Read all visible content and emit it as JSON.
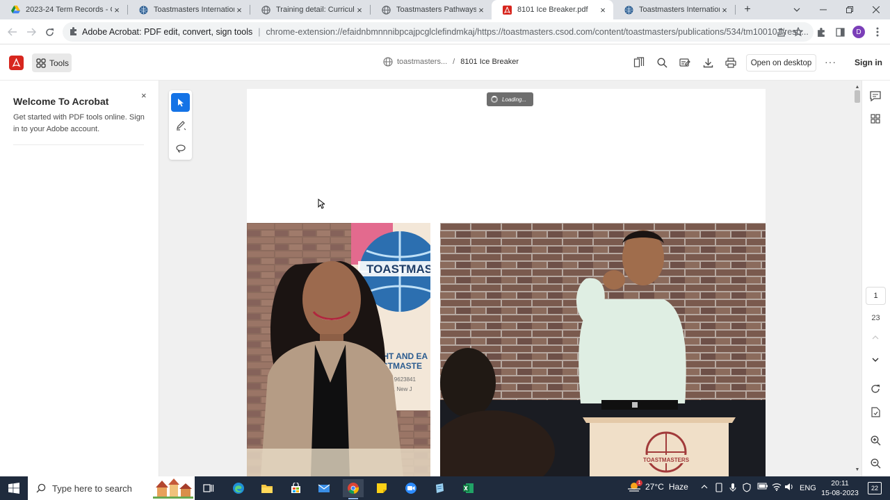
{
  "browser": {
    "tabs": [
      {
        "label": "2023-24 Term Records - Go",
        "icon": "google-drive-icon"
      },
      {
        "label": "Toastmasters International",
        "icon": "toastmasters-globe-icon"
      },
      {
        "label": "Training detail: Curriculum",
        "icon": "globe-icon"
      },
      {
        "label": "Toastmasters Pathways »» Ic",
        "icon": "globe-icon"
      },
      {
        "label": "8101 Ice Breaker.pdf",
        "icon": "adobe-pdf-icon",
        "active": true
      },
      {
        "label": "Toastmasters International",
        "icon": "toastmasters-globe-icon"
      }
    ],
    "close_glyph": "×",
    "new_tab_glyph": "+",
    "omnibox": {
      "site": "Adobe Acrobat: PDF edit, convert, sign tools",
      "separator": "|",
      "url": "chrome-extension://efaidnbmnnnibpcajpcglclefindmkaj/https://toastmasters.csod.com/content/toastmasters/publications/534/tm100101/reso..."
    },
    "profile_initial": "D"
  },
  "acrobat": {
    "tools_label": "Tools",
    "breadcrumb": {
      "site": "toastmasters...",
      "separator": "/",
      "document": "8101 Ice Breaker"
    },
    "open_desktop_label": "Open on desktop",
    "more_glyph": "···",
    "sign_in_label": "Sign in",
    "welcome": {
      "title": "Welcome To Acrobat",
      "body": "Get started with PDF tools online. Sign in to your Adobe account.",
      "close_glyph": "×"
    },
    "loading_label": "Loading...",
    "page_current": "1",
    "page_total": "23",
    "photo_sign": {
      "line1": "TOASTMAS",
      "line2": "GHT AND EA",
      "line3": "ASTMASTE",
      "line4": "ub No. 9623841",
      "line5": "orough, New J"
    },
    "podium_logo": "TOASTMASTERS"
  },
  "taskbar": {
    "search_placeholder": "Type here to search",
    "weather": {
      "temp": "27°C",
      "condition": "Haze",
      "badge": "1"
    },
    "language": "ENG",
    "time": "20:11",
    "date": "15-08-2023",
    "notifications": "22"
  },
  "colors": {
    "adobe_red": "#d7261e",
    "selected_tool": "#1473e6",
    "taskbar": "#1f2b3d"
  }
}
